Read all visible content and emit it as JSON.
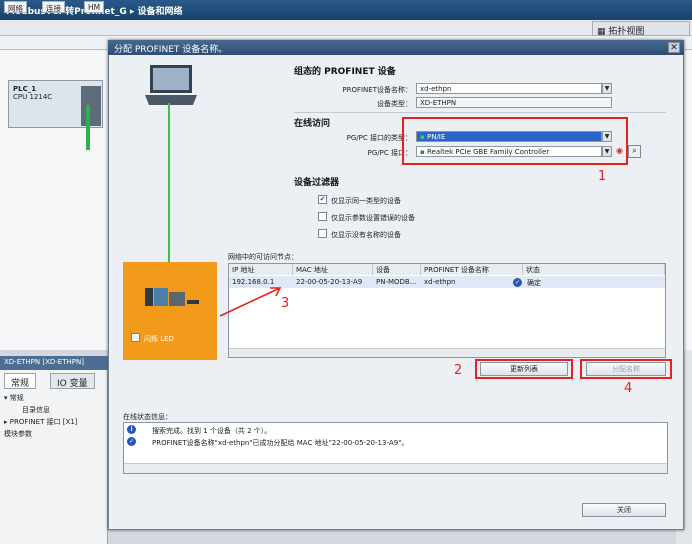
{
  "app": {
    "title": "ModbusTCP转Profinet_G ▸ 设备和网络",
    "topology_view": "拓扑视图",
    "view_tabs": [
      "网络",
      "连接",
      "HM"
    ],
    "plc_name": "PLC_1",
    "plc_type": "CPU 1214C"
  },
  "inspector": {
    "title": "XD-ETHPN [XD-ETHPN]",
    "tabs": [
      "常规",
      "IO 变量"
    ],
    "tree": [
      "▾ 常规",
      "目录信息",
      "▸ PROFINET 接口 [X1]",
      "模块参数"
    ]
  },
  "dialog": {
    "title": "分配 PROFINET 设备名称。",
    "configured_section": "组态的 PROFINET 设备",
    "device_name_label": "PROFINET设备名称：",
    "device_name_value": "xd-ethpn",
    "device_type_label": "设备类型：",
    "device_type_value": "XD-ETHPN",
    "online_section": "在线访问",
    "pgpc_type_label": "PG/PC 接口的类型：",
    "pgpc_type_value": "PN/IE",
    "pgpc_iface_label": "PG/PC 接口：",
    "pgpc_iface_value": "Realtek PCIe GBE Family Controller",
    "filter_section": "设备过滤器",
    "filters": [
      {
        "label": "仅显示同一类型的设备",
        "checked": true
      },
      {
        "label": "仅显示参数设置错误的设备",
        "checked": false
      },
      {
        "label": "仅显示没有名称的设备",
        "checked": false
      }
    ],
    "nodes_label": "网络中的可访问节点：",
    "table": {
      "headers": [
        "IP 地址",
        "MAC 地址",
        "设备",
        "PROFINET 设备名称",
        "状态"
      ],
      "rows": [
        [
          "192.168.0.1",
          "22-00-05-20-13-A9",
          "PN-MODB...",
          "xd-ethpn",
          "确定"
        ]
      ]
    },
    "flash_led_label": "闪烁 LED",
    "update_list_button": "更新列表",
    "assign_name_button": "分配名称",
    "status_label": "在线状态信息：",
    "status_messages": [
      "搜索完成。找到 1 个设备（共 2 个）。",
      "PROFINET设备名称\"xd-ethpn\"已成功分配给 MAC 地址\"22-00-05-20-13-A9\"。"
    ],
    "close_button": "关闭",
    "annotations": [
      "1",
      "2",
      "3",
      "4"
    ]
  },
  "colors": {
    "accent_red": "#e8231d",
    "panel_orange": "#f29b1a",
    "link_green": "#3bbf4f",
    "title_blue": "#2f4e73"
  }
}
